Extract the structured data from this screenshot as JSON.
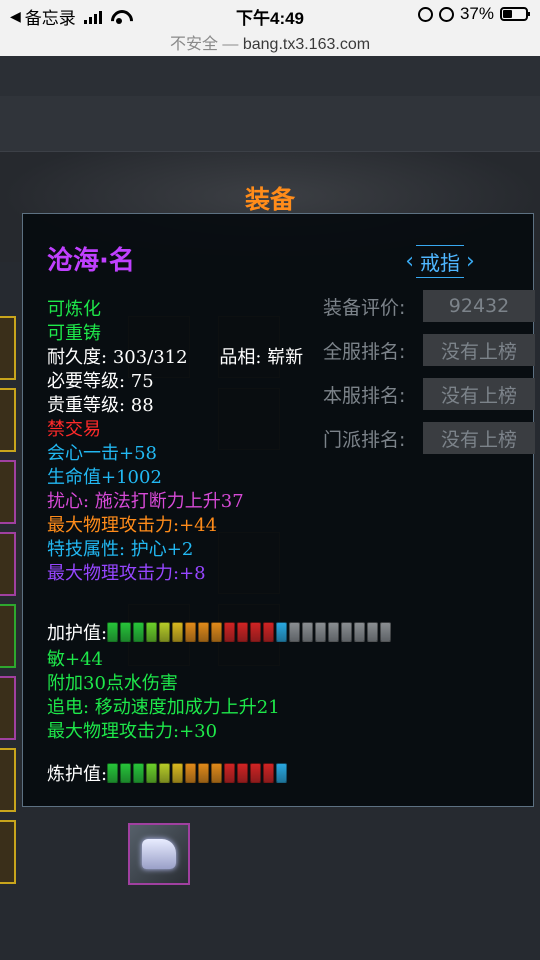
{
  "status_bar": {
    "back_label": "备忘录",
    "time": "下午4:49",
    "battery_text": "37%",
    "battery_level": 0.37
  },
  "url_bar": {
    "security_text": "不安全 —",
    "host": "bang.tx3.163.com"
  },
  "page": {
    "section_title": "装备"
  },
  "tooltip": {
    "item_name": "沧海·名",
    "item_type": "戒指",
    "ranks": [
      {
        "label": "装备评价:",
        "value": "92432"
      },
      {
        "label": "全服排名:",
        "value": "没有上榜"
      },
      {
        "label": "本服排名:",
        "value": "没有上榜"
      },
      {
        "label": "门派排名:",
        "value": "没有上榜"
      }
    ],
    "attributes_top": [
      {
        "text": "可炼化",
        "color": "green"
      },
      {
        "text": "可重铸",
        "color": "green"
      }
    ],
    "durability_label": "耐久度:",
    "durability_value": "303/312",
    "quality_label": "品相:",
    "quality_value": "崭新",
    "required_level": "必要等级: 75",
    "precious_level": "贵重等级: 88",
    "trade_status": "禁交易",
    "attributes_mid": [
      {
        "text": "会心一击+58",
        "color": "cyan"
      },
      {
        "text": "生命值+1002",
        "color": "cyan"
      },
      {
        "text": "扰心: 施法打断力上升37",
        "color": "magenta"
      },
      {
        "text": "最大物理攻击力:+44",
        "color": "orange"
      },
      {
        "text": "特技属性: 护心+2",
        "color": "cyan"
      },
      {
        "text": "最大物理攻击力:+8",
        "color": "purple"
      }
    ],
    "protect_label": "加护值:",
    "attributes_bottom": [
      {
        "text": "敏+44",
        "color": "green"
      },
      {
        "text": "附加30点水伤害",
        "color": "green"
      },
      {
        "text": "追电: 移动速度加成力上升21",
        "color": "green"
      },
      {
        "text": "最大物理攻击力:+30",
        "color": "green"
      }
    ],
    "refine_label": "炼护值:"
  },
  "gauges": {
    "protect": {
      "segments": [
        "#27c43a",
        "#27c43a",
        "#27c43a",
        "#6ccf2a",
        "#b6cc28",
        "#d8b820",
        "#e08a1a",
        "#e08a1a",
        "#e08a1a",
        "#d02424",
        "#d02424",
        "#d02424",
        "#d02424",
        "#2aa8e0",
        "#8a8e92",
        "#8a8e92",
        "#8a8e92",
        "#8a8e92",
        "#8a8e92",
        "#8a8e92",
        "#8a8e92",
        "#8a8e92"
      ]
    },
    "refine": {
      "segments": [
        "#27c43a",
        "#27c43a",
        "#27c43a",
        "#6ccf2a",
        "#b6cc28",
        "#d8b820",
        "#e08a1a",
        "#e08a1a",
        "#e08a1a",
        "#d02424",
        "#d02424",
        "#d02424",
        "#d02424",
        "#2aa8e0"
      ]
    }
  },
  "colors": {
    "green": "#1ee84a",
    "white": "#ffffff",
    "red": "#ff2a2a",
    "cyan": "#22b8f2",
    "magenta": "#d64ad6",
    "orange": "#ff8c1a",
    "purple": "#9646ff"
  }
}
